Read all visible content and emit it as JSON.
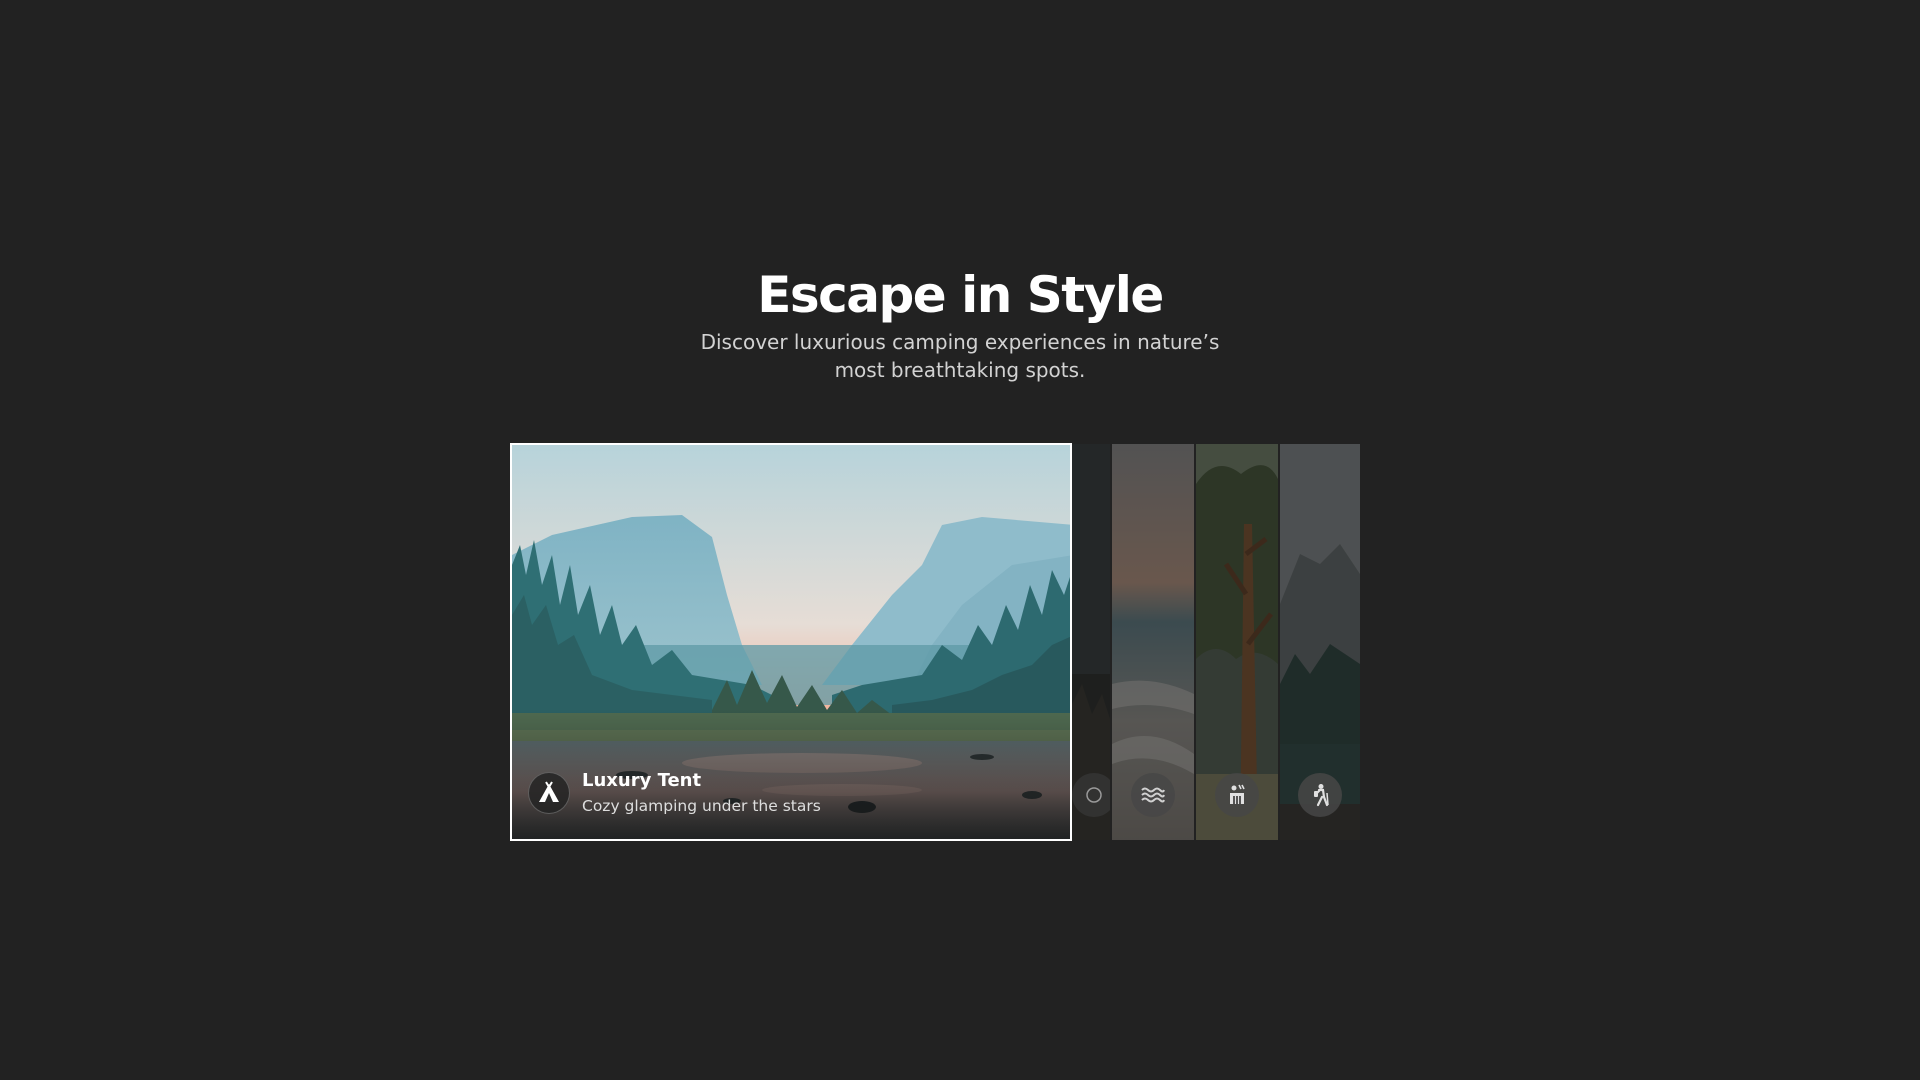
{
  "hero": {
    "title": "Escape in Style",
    "subtitle": "Discover luxurious camping experiences in nature’s most breathtaking spots."
  },
  "gallery": {
    "active_index": 0,
    "items": [
      {
        "title": "Luxury Tent",
        "description": "Cozy glamping under the stars",
        "icon": "tent-icon",
        "active": true
      },
      {
        "icon": "campfire-icon",
        "active": false
      },
      {
        "icon": "water-waves-icon",
        "active": false
      },
      {
        "icon": "cabin-icon",
        "active": false
      },
      {
        "icon": "hiker-icon",
        "active": false
      }
    ]
  },
  "colors": {
    "background": "#222222",
    "title": "#ffffff",
    "subtitle": "#d2d2d2",
    "active_border": "#ffffff"
  }
}
